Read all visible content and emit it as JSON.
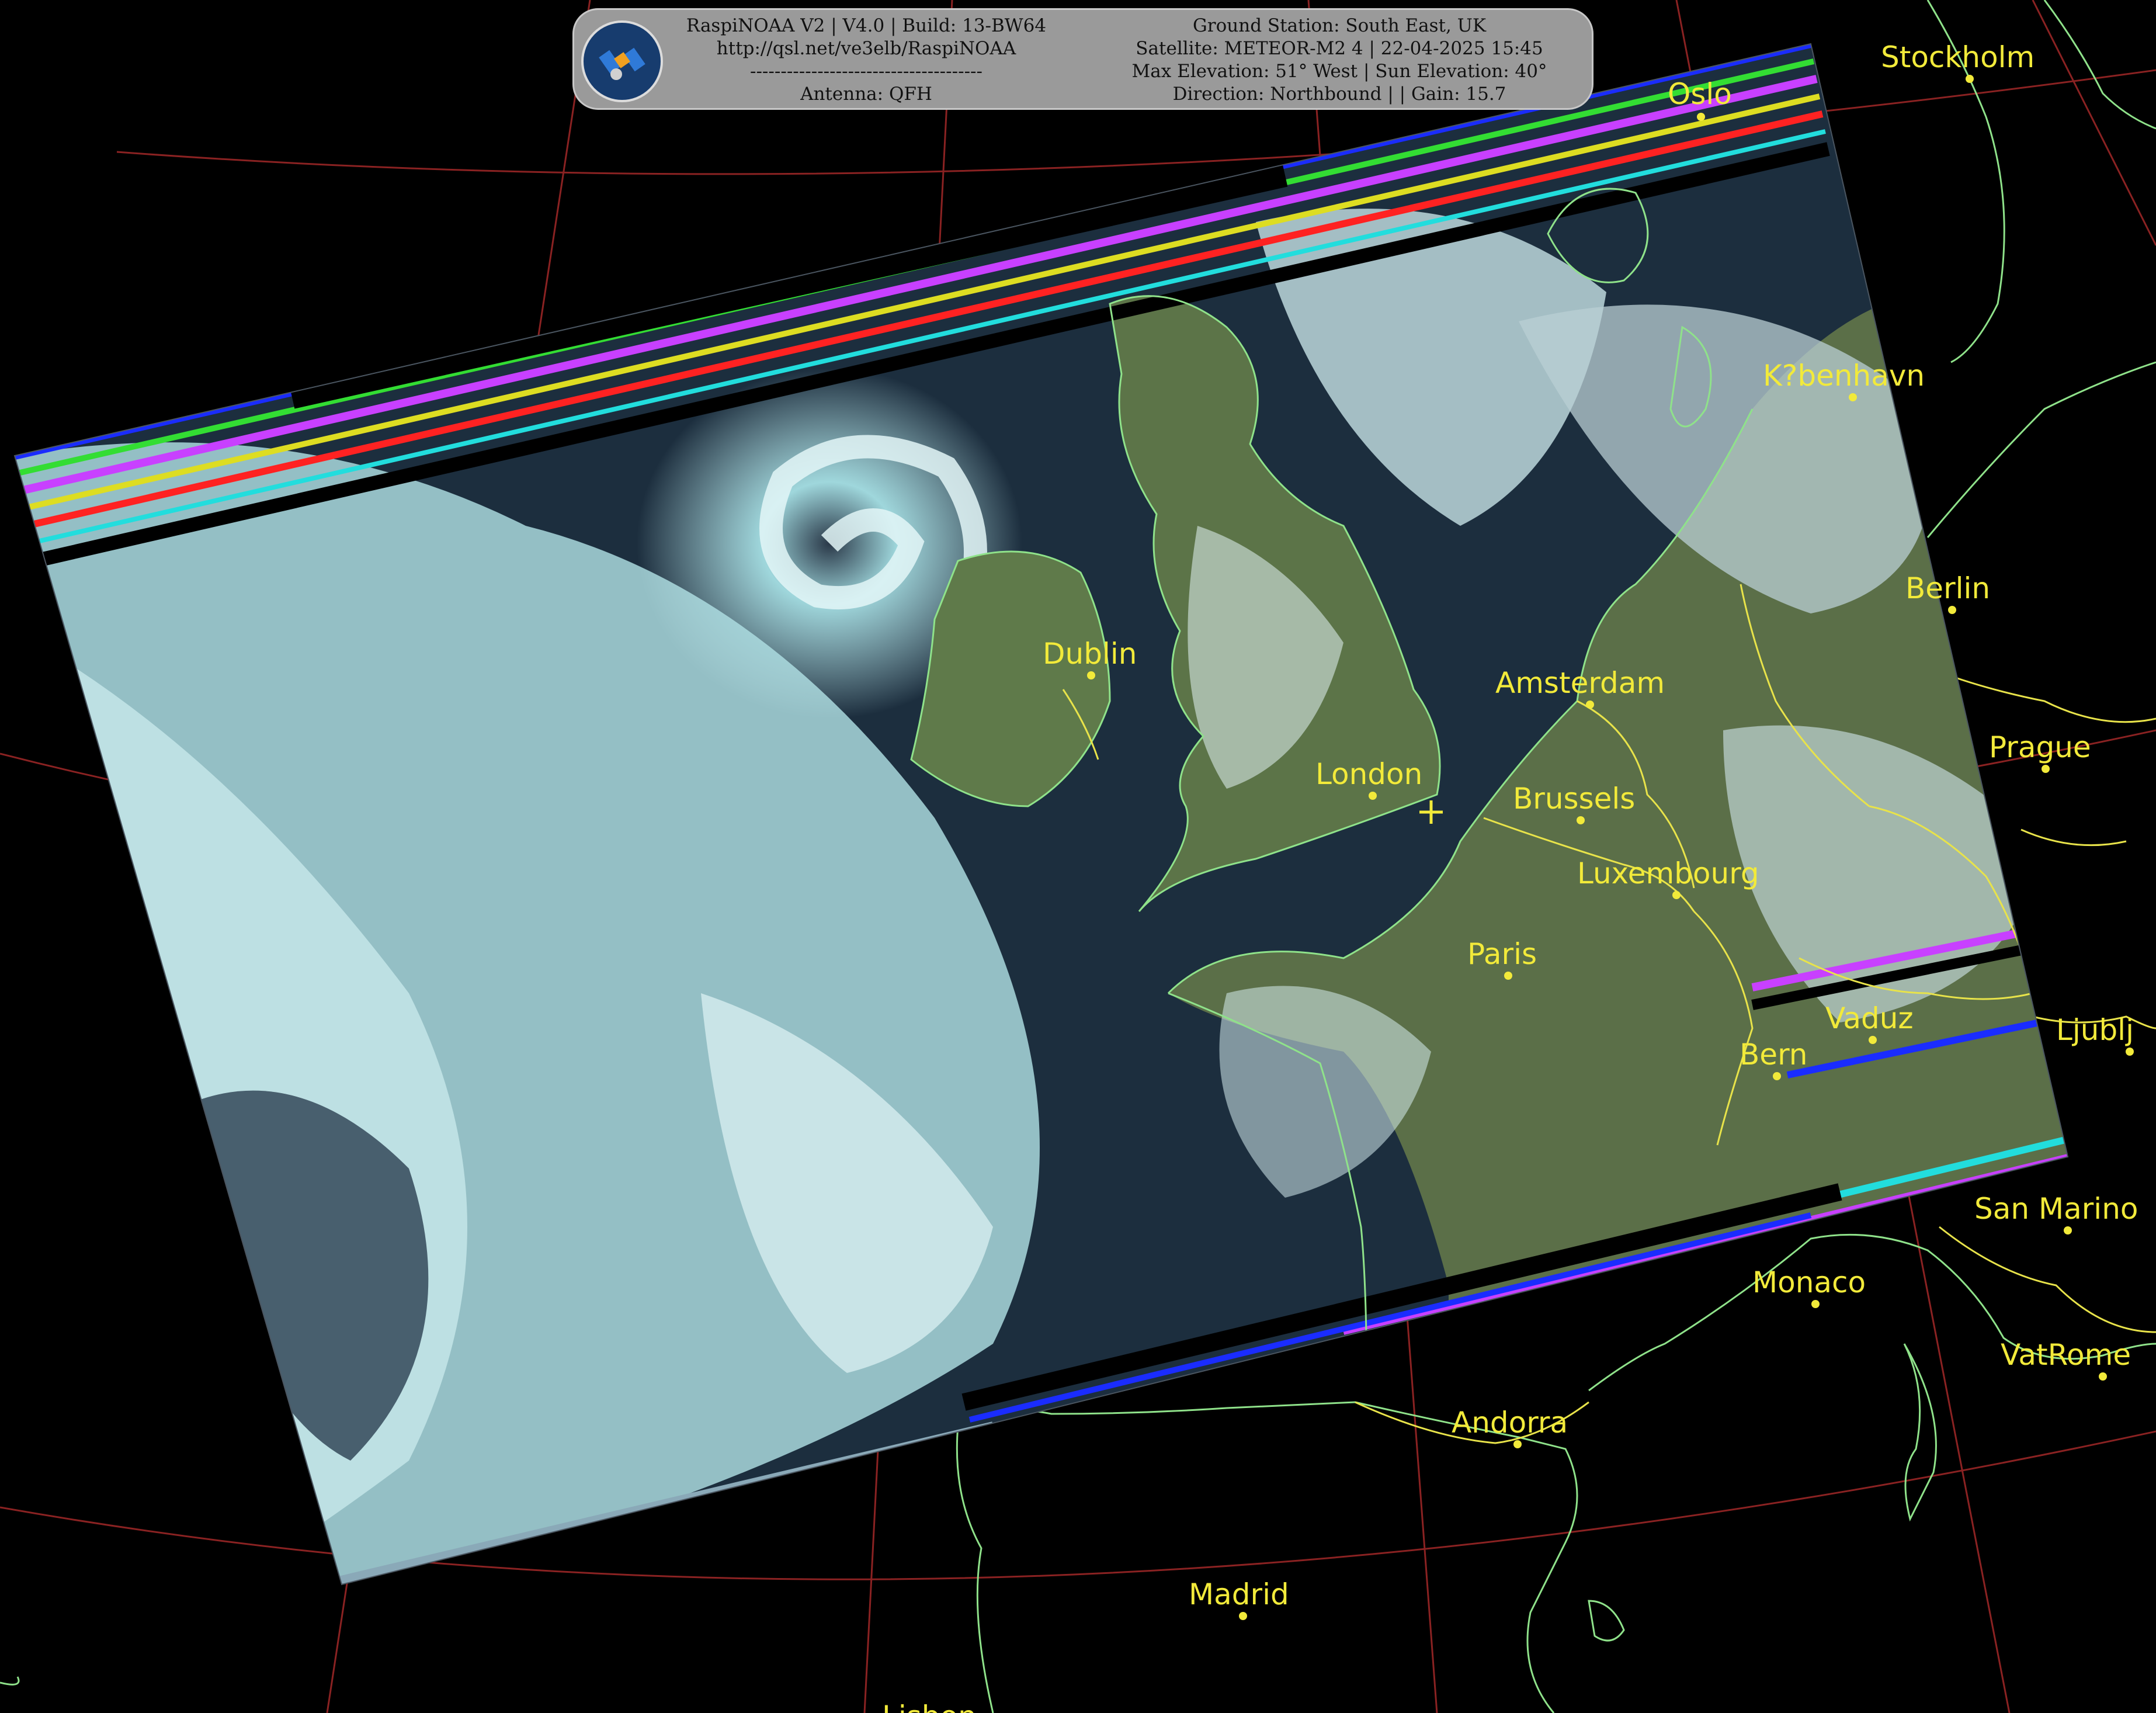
{
  "info_panel": {
    "left_lines": [
      "RaspiNOAA V2 | V4.0 | Build: 13-BW64",
      "http://qsl.net/ve3elb/RaspiNOAA",
      "--------------------------------------",
      "Antenna: QFH"
    ],
    "right_lines": [
      "Ground Station: South East, UK",
      "Satellite: METEOR-M2 4 | 22-04-2025 15:45",
      "Max Elevation: 51° West | Sun Elevation: 40°",
      "Direction: Northbound | | Gain: 15.7"
    ],
    "logo_icon": "satellite-icon"
  },
  "cities": [
    "Stockholm",
    "Oslo",
    "K?benhavn",
    "Berlin",
    "Prague",
    "Dublin",
    "Amsterdam",
    "London",
    "Brussels",
    "Luxembourg",
    "Paris",
    "Vaduz",
    "Bern",
    "Ljublj",
    "San Marino",
    "Monaco",
    "VatRome",
    "Andorra",
    "Madrid",
    "Lisbon"
  ],
  "colors": {
    "background": "#000000",
    "coastline": "#8fe28a",
    "border": "#e8e34a",
    "graticule": "#8a2222",
    "city_label": "#f2ea3a",
    "cloud": "#bfe8ec",
    "ocean": "#1c2e3e",
    "land": "#556d45"
  }
}
